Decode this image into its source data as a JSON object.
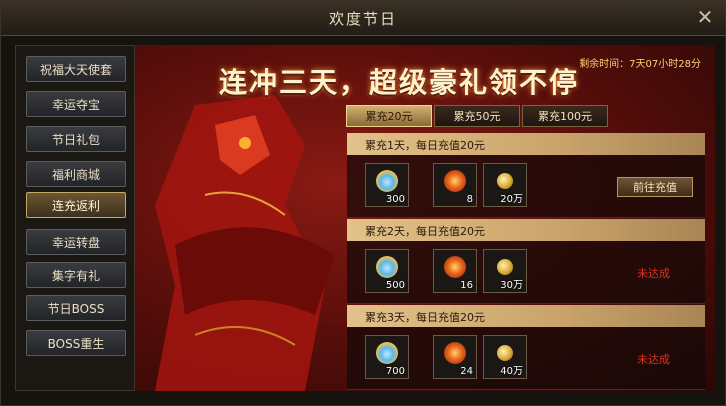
{
  "window": {
    "title": "欢度节日",
    "close_label": "✕"
  },
  "sidebar": {
    "items": [
      {
        "label": "祝福大天使套"
      },
      {
        "label": "幸运夺宝"
      },
      {
        "label": "节日礼包"
      },
      {
        "label": "福利商城"
      },
      {
        "label": "连充返利",
        "active": true
      },
      {
        "label": "幸运转盘"
      },
      {
        "label": "集字有礼"
      },
      {
        "label": "节日BOSS"
      },
      {
        "label": "BOSS重生"
      }
    ]
  },
  "main": {
    "banner": "连冲三天，超级豪礼领不停",
    "countdown": "剩余时间：7天07小时28分",
    "tabs": [
      {
        "label": "累充20元",
        "active": true
      },
      {
        "label": "累充50元"
      },
      {
        "label": "累充100元"
      }
    ],
    "rewards": [
      {
        "label": "累充1天，每日充值20元",
        "items": [
          {
            "icon": "cloud-icon",
            "count": "300"
          },
          {
            "icon": "leaf-icon",
            "count": "8"
          },
          {
            "icon": "coin-icon",
            "count": "20万"
          }
        ],
        "action": "前往充值"
      },
      {
        "label": "累充2天，每日充值20元",
        "items": [
          {
            "icon": "cloud-icon",
            "count": "500"
          },
          {
            "icon": "leaf-icon",
            "count": "16"
          },
          {
            "icon": "coin-icon",
            "count": "30万"
          }
        ],
        "status": "未达成"
      },
      {
        "label": "累充3天，每日充值20元",
        "items": [
          {
            "icon": "cloud-icon",
            "count": "700"
          },
          {
            "icon": "leaf-icon",
            "count": "24"
          },
          {
            "icon": "coin-icon",
            "count": "40万"
          }
        ],
        "status": "未达成"
      }
    ]
  },
  "colors": {
    "accent_gold": "#c8a866",
    "status_red": "#e0301e",
    "banner_bg": "#8a1a14"
  }
}
